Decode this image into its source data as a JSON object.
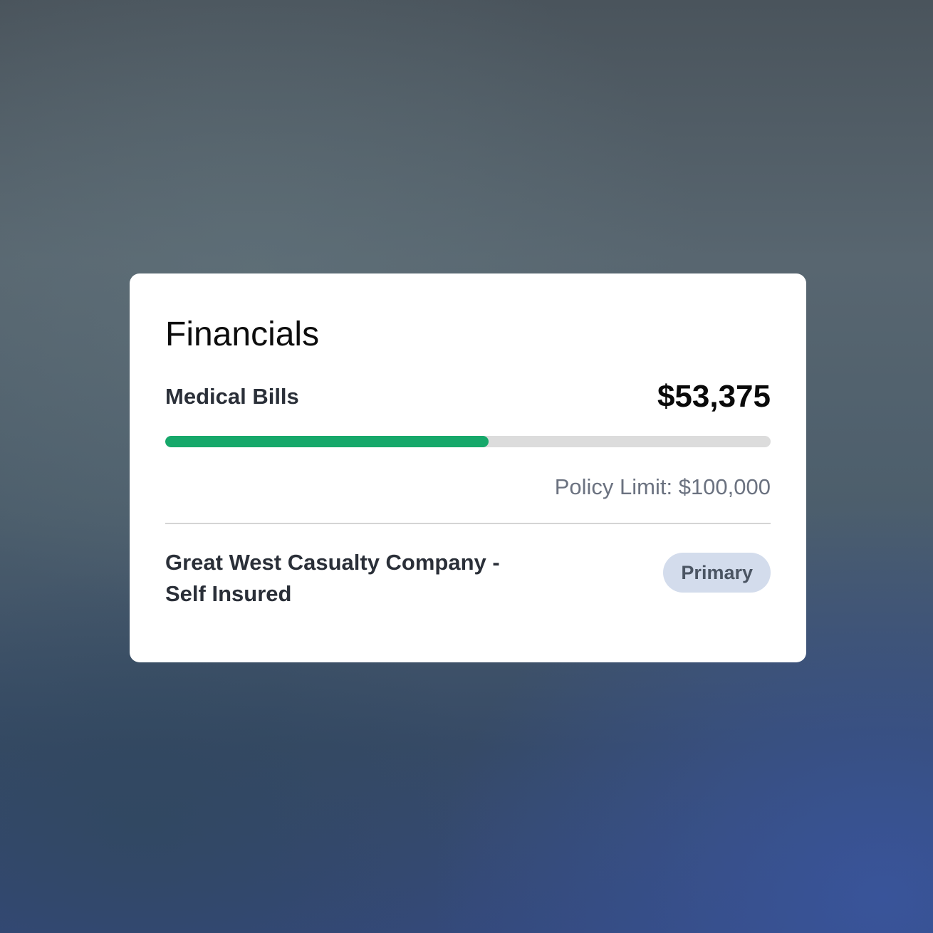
{
  "card": {
    "title": "Financials",
    "medical_bills": {
      "label": "Medical Bills",
      "amount": "$53,375",
      "progress_fraction": 0.534,
      "progress_color": "#16a86a",
      "track_color": "#dcdcdc"
    },
    "policy_limit": "Policy Limit: $100,000",
    "insurer": {
      "name": "Great West Casualty Company - Self Insured",
      "badge": "Primary"
    }
  }
}
